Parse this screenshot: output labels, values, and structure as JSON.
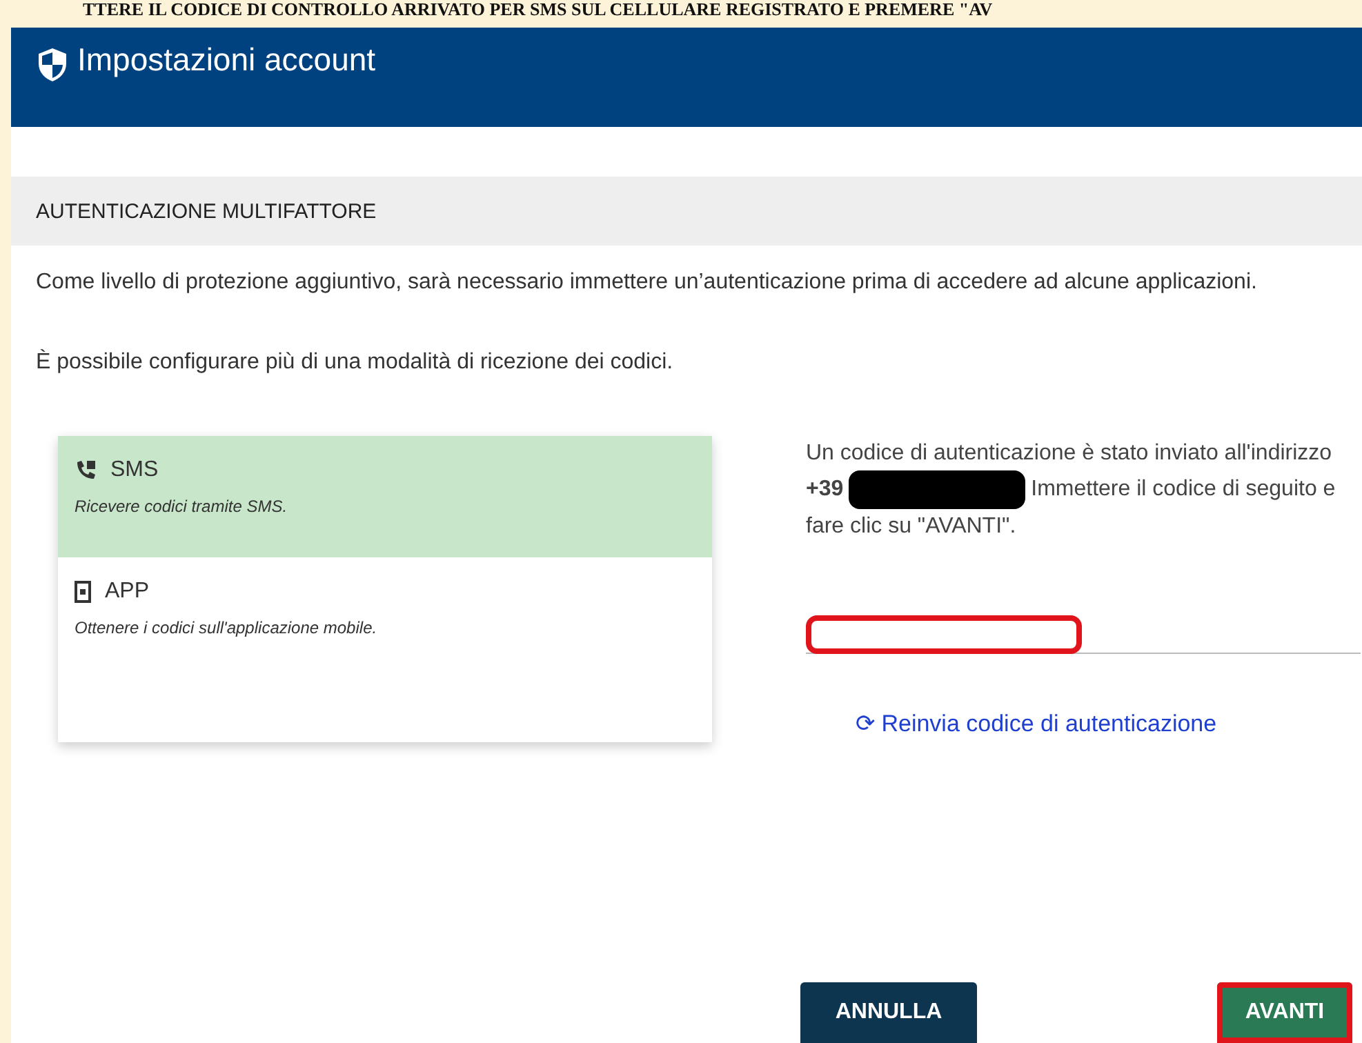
{
  "annotation": {
    "text": "TTERE IL CODICE DI CONTROLLO ARRIVATO PER SMS SUL CELLULARE REGISTRATO E PREMERE \"AV"
  },
  "header": {
    "title": "Impostazioni account"
  },
  "section": {
    "title": "AUTENTICAZIONE MULTIFATTORE"
  },
  "intro": [
    "Come livello di protezione aggiuntivo, sarà necessario immettere un’autenticazione prima di accedere ad alcune applicazioni.",
    "È possibile configurare più di una modalità di ricezione dei codici."
  ],
  "methods": [
    {
      "kind": "sms",
      "name": "SMS",
      "description": "Ricevere codici tramite SMS.",
      "selected": true
    },
    {
      "kind": "app",
      "name": "APP",
      "description": "Ottenere i codici sull'applicazione mobile.",
      "selected": false
    }
  ],
  "message": {
    "before": "Un codice di autenticazione è stato inviato all'indirizzo **+39**",
    "after": "Immettere il codice di seguito e fare clic su \"AVANTI\"."
  },
  "code_field": {
    "highlighted": true
  },
  "resend_link": {
    "icon": "⟳",
    "label": "Reinvia codice di autenticazione"
  },
  "buttons": [
    {
      "kind": "cancel",
      "label": "ANNULLA",
      "highlighted": false
    },
    {
      "kind": "next",
      "label": "AVANTI",
      "highlighted": true
    }
  ]
}
